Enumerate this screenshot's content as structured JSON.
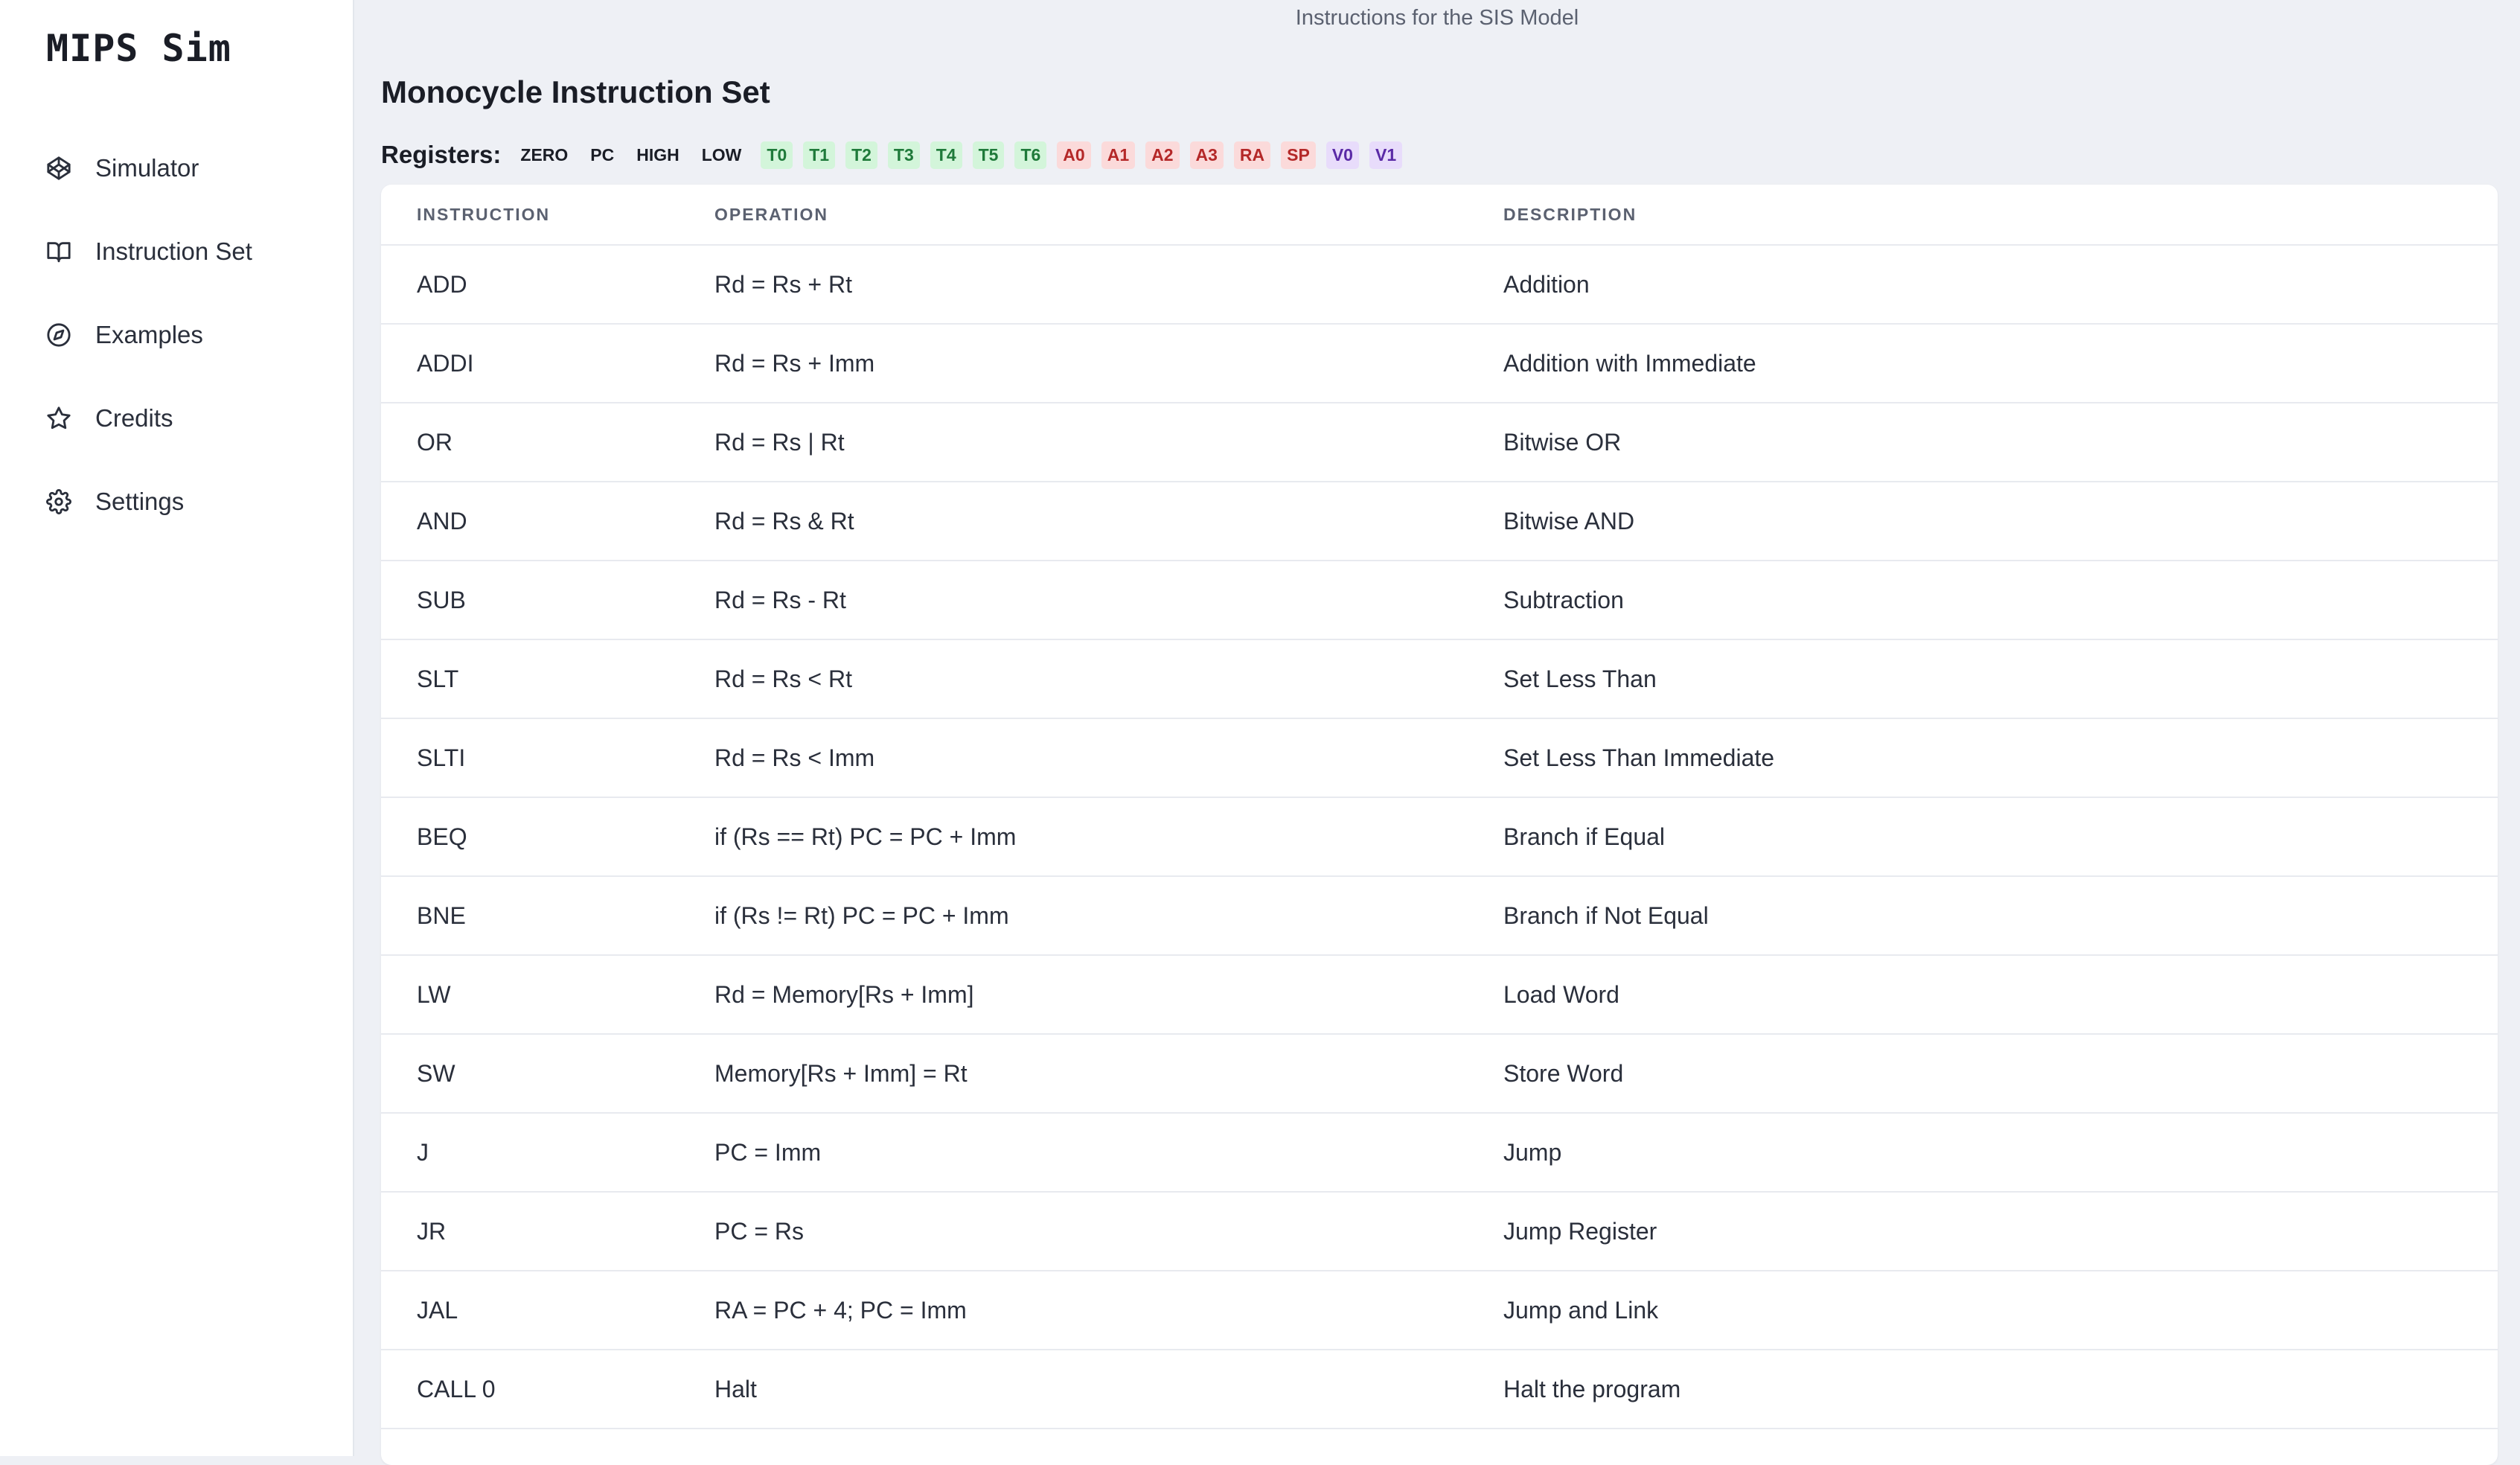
{
  "sidebar": {
    "logo": "MIPS Sim",
    "items": [
      {
        "label": "Simulator",
        "icon": "codepen-icon"
      },
      {
        "label": "Instruction Set",
        "icon": "book-icon"
      },
      {
        "label": "Examples",
        "icon": "compass-icon"
      },
      {
        "label": "Credits",
        "icon": "star-icon"
      },
      {
        "label": "Settings",
        "icon": "gear-icon"
      }
    ]
  },
  "main": {
    "caption": "Instructions for the SIS Model",
    "title": "Monocycle Instruction Set",
    "registers_label": "Registers:",
    "registers": [
      {
        "name": "ZERO",
        "kind": "plain"
      },
      {
        "name": "PC",
        "kind": "plain"
      },
      {
        "name": "HIGH",
        "kind": "plain"
      },
      {
        "name": "LOW",
        "kind": "plain"
      },
      {
        "name": "T0",
        "kind": "green"
      },
      {
        "name": "T1",
        "kind": "green"
      },
      {
        "name": "T2",
        "kind": "green"
      },
      {
        "name": "T3",
        "kind": "green"
      },
      {
        "name": "T4",
        "kind": "green"
      },
      {
        "name": "T5",
        "kind": "green"
      },
      {
        "name": "T6",
        "kind": "green"
      },
      {
        "name": "A0",
        "kind": "red"
      },
      {
        "name": "A1",
        "kind": "red"
      },
      {
        "name": "A2",
        "kind": "red"
      },
      {
        "name": "A3",
        "kind": "red"
      },
      {
        "name": "RA",
        "kind": "red"
      },
      {
        "name": "SP",
        "kind": "red"
      },
      {
        "name": "V0",
        "kind": "purple"
      },
      {
        "name": "V1",
        "kind": "purple"
      }
    ],
    "colors": {
      "green_bg": "#d3f5da",
      "green_fg": "#1f7a3a",
      "red_bg": "#fbdada",
      "red_fg": "#b42828",
      "purple_bg": "#e8dcfb",
      "purple_fg": "#5a2aa6"
    },
    "table": {
      "headers": [
        "INSTRUCTION",
        "OPERATION",
        "DESCRIPTION"
      ],
      "rows": [
        [
          "ADD",
          "Rd = Rs + Rt",
          "Addition"
        ],
        [
          "ADDI",
          "Rd = Rs + Imm",
          "Addition with Immediate"
        ],
        [
          "OR",
          "Rd = Rs | Rt",
          "Bitwise OR"
        ],
        [
          "AND",
          "Rd = Rs & Rt",
          "Bitwise AND"
        ],
        [
          "SUB",
          "Rd = Rs - Rt",
          "Subtraction"
        ],
        [
          "SLT",
          "Rd = Rs < Rt",
          "Set Less Than"
        ],
        [
          "SLTI",
          "Rd = Rs < Imm",
          "Set Less Than Immediate"
        ],
        [
          "BEQ",
          "if (Rs == Rt) PC = PC + Imm",
          "Branch if Equal"
        ],
        [
          "BNE",
          "if (Rs != Rt) PC = PC + Imm",
          "Branch if Not Equal"
        ],
        [
          "LW",
          "Rd = Memory[Rs + Imm]",
          "Load Word"
        ],
        [
          "SW",
          "Memory[Rs + Imm] = Rt",
          "Store Word"
        ],
        [
          "J",
          "PC = Imm",
          "Jump"
        ],
        [
          "JR",
          "PC = Rs",
          "Jump Register"
        ],
        [
          "JAL",
          "RA = PC + 4; PC = Imm",
          "Jump and Link"
        ],
        [
          "CALL 0",
          "Halt",
          "Halt the program"
        ]
      ]
    }
  }
}
